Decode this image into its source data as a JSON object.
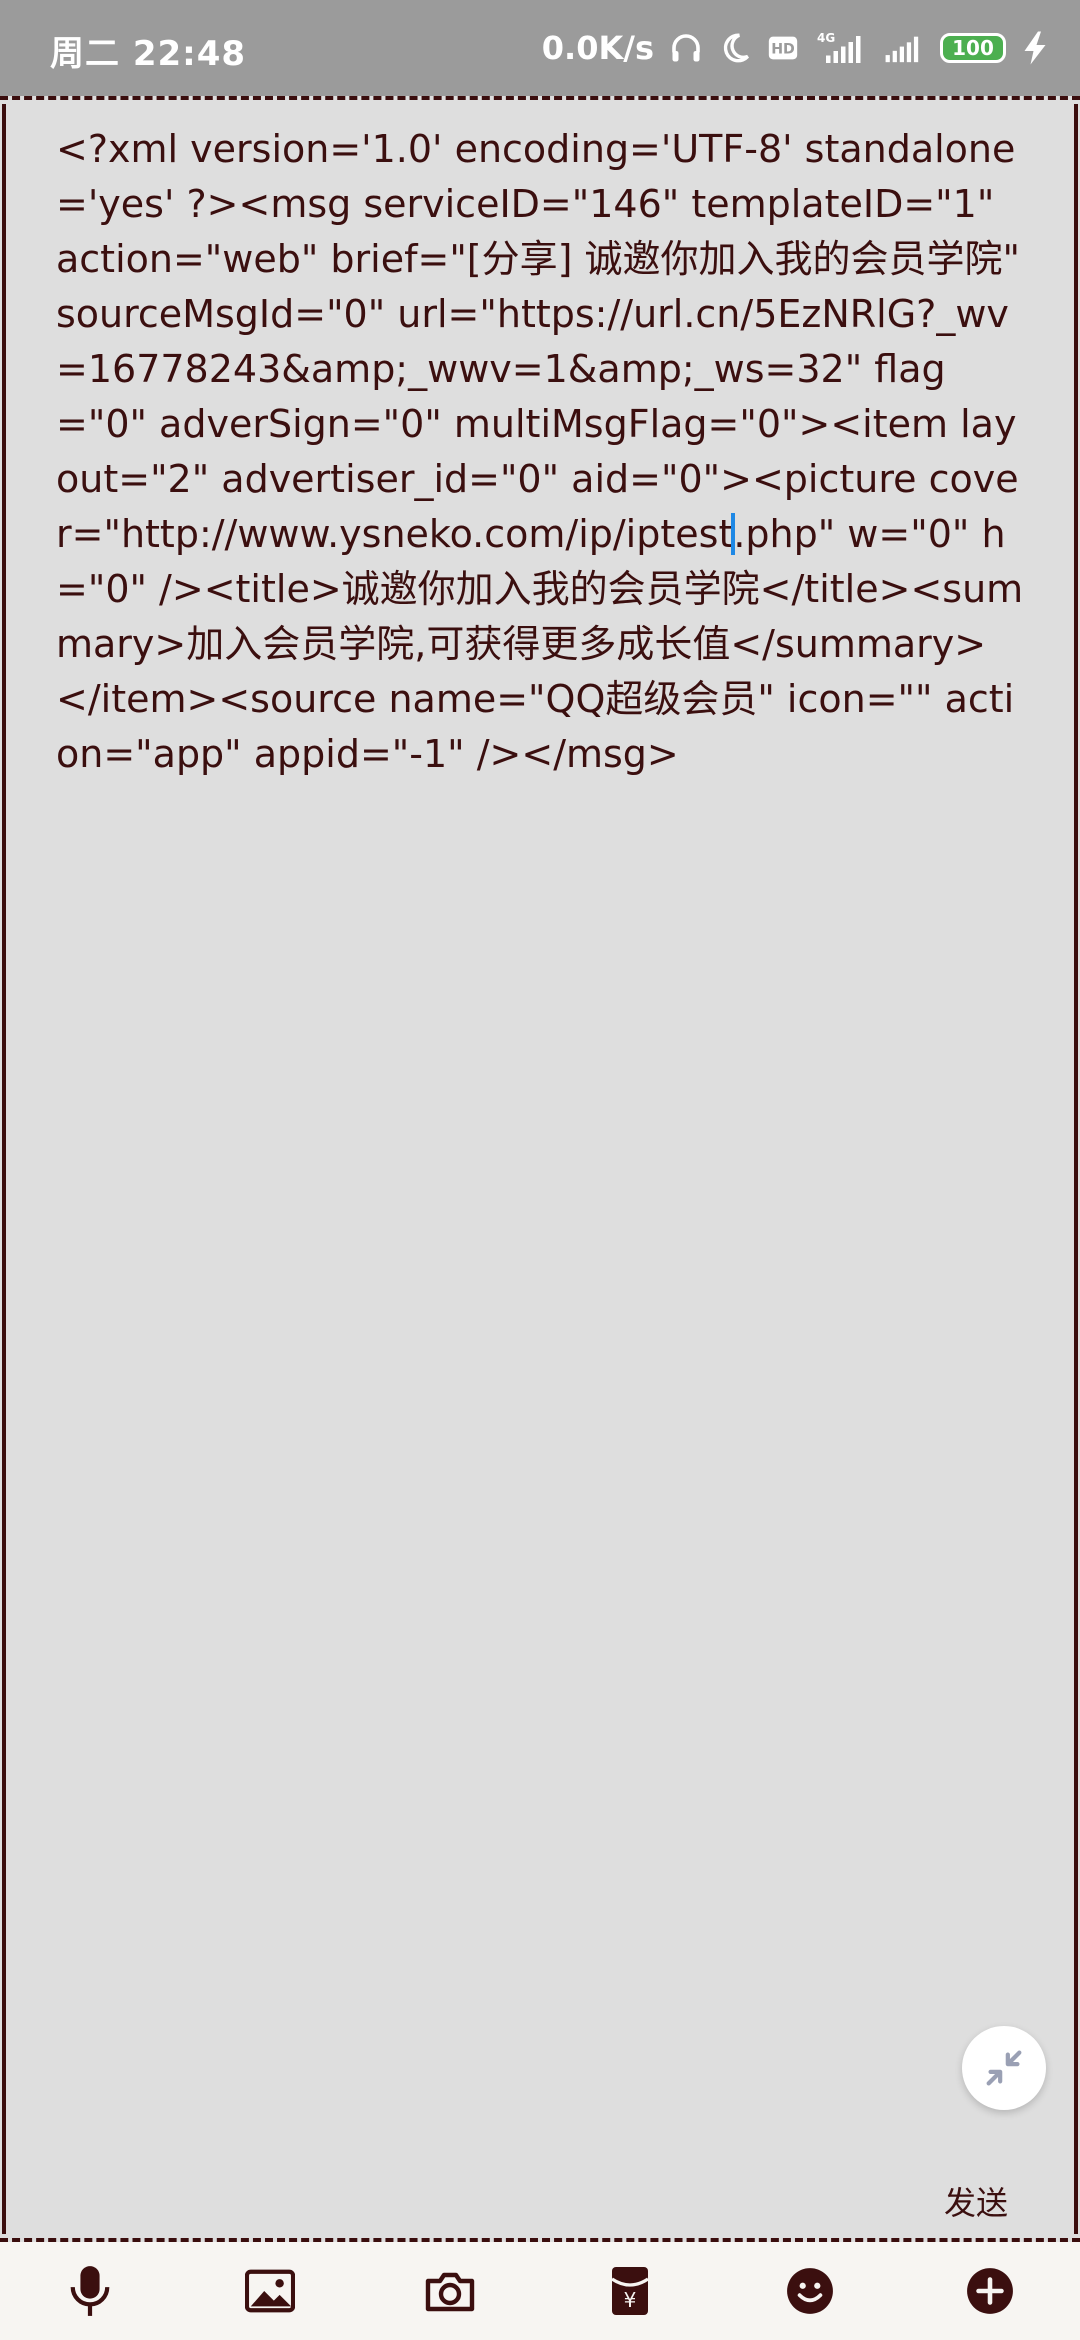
{
  "status_bar": {
    "time": "周二 22:48",
    "net_speed": "0.0K/s",
    "network_type": "4G",
    "hd_label": "HD",
    "battery_level": "100",
    "icons": [
      "headphones-icon",
      "moon-icon",
      "hd-icon",
      "signal-4g-icon",
      "signal-icon",
      "battery-icon",
      "charging-icon"
    ]
  },
  "editor": {
    "text_before_cursor": "<?xml version='1.0' encoding='UTF-8' standalone='yes' ?><msg serviceID=\"146\" templateID=\"1\" action=\"web\" brief=\"[分享] 诚邀你加入我的会员学院\" sourceMsgId=\"0\" url=\"https://url.cn/5EzNRlG?_wv=16778243&amp;_wwv=1&amp;_ws=32\" flag=\"0\" adverSign=\"0\" multiMsgFlag=\"0\"><item layout=\"2\" advertiser_id=\"0\" aid=\"0\"><picture cover=\"http://www.ysneko.com/ip/iptest",
    "text_after_cursor": ".php\" w=\"0\" h=\"0\" /><title>诚邀你加入我的会员学院</title><summary>加入会员学院,可获得更多成长值</summary></item><source name=\"QQ超级会员\" icon=\"\" action=\"app\" appid=\"-1\" /></msg>",
    "send_label": "发送",
    "collapse_icon": "collapse-icon"
  },
  "toolbar": {
    "items": [
      {
        "name": "voice",
        "icon": "microphone-icon"
      },
      {
        "name": "image",
        "icon": "image-icon"
      },
      {
        "name": "camera",
        "icon": "camera-icon"
      },
      {
        "name": "red-packet",
        "icon": "red-packet-icon",
        "glyph": "¥"
      },
      {
        "name": "emoji",
        "icon": "emoji-icon"
      },
      {
        "name": "more",
        "icon": "plus-icon"
      }
    ]
  },
  "colors": {
    "editor_bg": "#dedede",
    "text": "#3b0f0f",
    "border": "#3a0d0d",
    "cursor": "#1e88e5",
    "status_bar": "#9b9b9b",
    "toolbar_bg": "#f7f5f2",
    "battery": "#4caf50"
  }
}
